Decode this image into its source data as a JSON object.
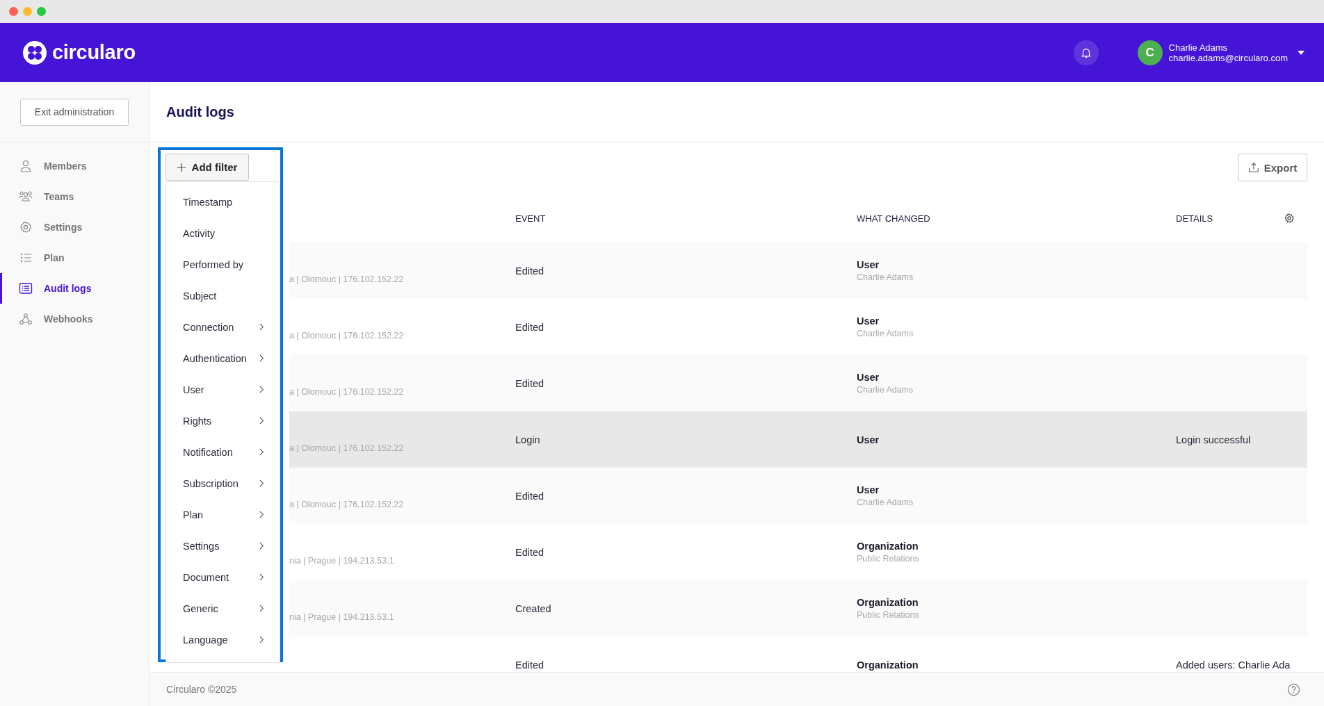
{
  "header": {
    "brand": "circularo",
    "user": {
      "initial": "C",
      "name": "Charlie Adams",
      "email": "charlie.adams@circularo.com"
    }
  },
  "sidebar": {
    "exit_button": "Exit administration",
    "items": [
      {
        "label": "Members",
        "selected": false
      },
      {
        "label": "Teams",
        "selected": false
      },
      {
        "label": "Settings",
        "selected": false
      },
      {
        "label": "Plan",
        "selected": false
      },
      {
        "label": "Audit logs",
        "selected": true
      },
      {
        "label": "Webhooks",
        "selected": false
      }
    ]
  },
  "page_title": "Audit logs",
  "toolbar": {
    "add_filter": "Add filter",
    "export": "Export"
  },
  "filter_menu": {
    "items": [
      {
        "label": "Timestamp",
        "has_submenu": false
      },
      {
        "label": "Activity",
        "has_submenu": false
      },
      {
        "label": "Performed by",
        "has_submenu": false
      },
      {
        "label": "Subject",
        "has_submenu": false
      },
      {
        "label": "Connection",
        "has_submenu": true
      },
      {
        "label": "Authentication",
        "has_submenu": true
      },
      {
        "label": "User",
        "has_submenu": true
      },
      {
        "label": "Rights",
        "has_submenu": true
      },
      {
        "label": "Notification",
        "has_submenu": true
      },
      {
        "label": "Subscription",
        "has_submenu": true
      },
      {
        "label": "Plan",
        "has_submenu": true
      },
      {
        "label": "Settings",
        "has_submenu": true
      },
      {
        "label": "Document",
        "has_submenu": true
      },
      {
        "label": "Generic",
        "has_submenu": true
      },
      {
        "label": "Language",
        "has_submenu": true
      }
    ]
  },
  "table": {
    "columns": [
      "EVENT",
      "WHAT CHANGED",
      "DETAILS"
    ],
    "rows": [
      {
        "location": "a | Olomouc | 176.102.152.22",
        "event": "Edited",
        "subject": "User",
        "subject_detail": "Charlie Adams",
        "highlighted": false
      },
      {
        "location": "a | Olomouc | 176.102.152.22",
        "event": "Edited",
        "subject": "User",
        "subject_detail": "Charlie Adams",
        "highlighted": false
      },
      {
        "location": "a | Olomouc | 176.102.152.22",
        "event": "Edited",
        "subject": "User",
        "subject_detail": "Charlie Adams",
        "highlighted": false
      },
      {
        "location": "a | Olomouc | 176.102.152.22",
        "event": "Login",
        "subject": "User",
        "details": "Login successful",
        "highlighted": true
      },
      {
        "location": "a | Olomouc | 176.102.152.22",
        "event": "Edited",
        "subject": "User",
        "subject_detail": "Charlie Adams",
        "highlighted": false
      },
      {
        "location": "nia | Prague | 194.213.53.1",
        "event": "Edited",
        "subject": "Organization",
        "subject_detail": "Public Relations",
        "highlighted": false
      },
      {
        "location": "nia | Prague | 194.213.53.1",
        "event": "Created",
        "subject": "Organization",
        "subject_detail": "Public Relations",
        "highlighted": false
      },
      {
        "event": "Edited",
        "subject": "Organization",
        "details": "Added users: Charlie Ada",
        "highlighted": false
      }
    ]
  },
  "footer": {
    "copyright": "Circularo ©2025"
  }
}
